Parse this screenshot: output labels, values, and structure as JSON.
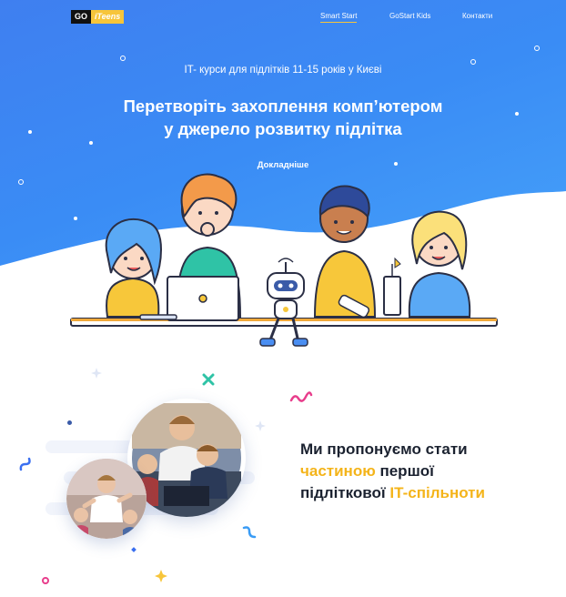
{
  "header": {
    "logo": {
      "part1": "GO",
      "part2": "iTeens"
    },
    "nav": [
      {
        "label": "Smart Start",
        "active": true
      },
      {
        "label": "GoStart Kids",
        "active": false
      },
      {
        "label": "Контакти",
        "active": false
      }
    ]
  },
  "hero": {
    "subtitle": "IT- курси для підлітків 11-15 років у Києві",
    "headline_line1": "Перетворіть захоплення комп’ютером",
    "headline_line2": "у джерело розвитку підлітка",
    "cta_label": "Докладніше"
  },
  "offer": {
    "line1": "Ми пропонуємо стати",
    "line2_highlight": "частиною",
    "line2_rest": " першої",
    "line3_start": "підліткової ",
    "line3_highlight": "IT-спільноти"
  },
  "colors": {
    "hero_gradient_start": "#3f7ff0",
    "hero_gradient_end": "#48a6fa",
    "accent_yellow": "#f4b41a",
    "text_dark": "#1b2230"
  }
}
